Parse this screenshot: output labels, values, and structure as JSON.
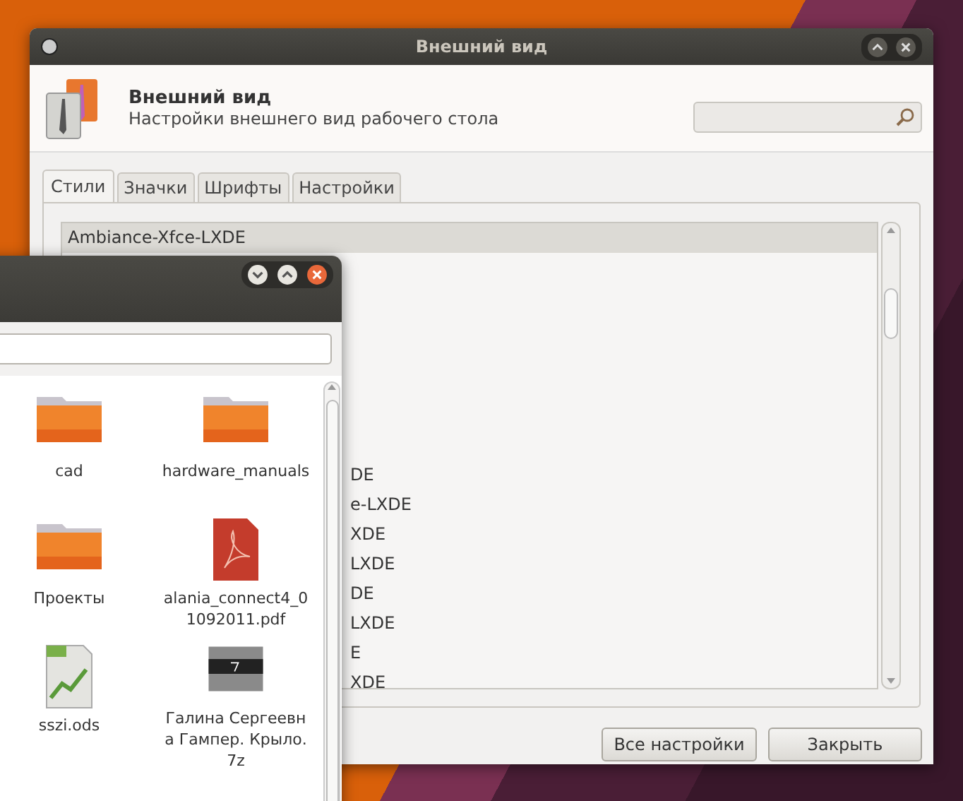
{
  "appearance_window": {
    "title": "Внешний вид",
    "header": {
      "title": "Внешний вид",
      "subtitle": "Настройки внешнего вид рабочего стола"
    },
    "tabs": [
      {
        "label": "Стили",
        "selected": true
      },
      {
        "label": "Значки",
        "selected": false
      },
      {
        "label": "Шрифты",
        "selected": false
      },
      {
        "label": "Настройки",
        "selected": false
      }
    ],
    "themes": [
      {
        "name": "Ambiance-Xfce-LXDE",
        "selected": true,
        "kind": "full"
      },
      {
        "name": "DE",
        "selected": false,
        "kind": "partial"
      },
      {
        "name": "e-LXDE",
        "selected": false,
        "kind": "partial"
      },
      {
        "name": "XDE",
        "selected": false,
        "kind": "partial"
      },
      {
        "name": "LXDE",
        "selected": false,
        "kind": "partial"
      },
      {
        "name": "DE",
        "selected": false,
        "kind": "partial"
      },
      {
        "name": "LXDE",
        "selected": false,
        "kind": "partial"
      },
      {
        "name": "E",
        "selected": false,
        "kind": "partial"
      },
      {
        "name": "XDE",
        "selected": false,
        "kind": "partial"
      }
    ],
    "buttons": [
      "Все настройки",
      "Закрыть"
    ]
  },
  "file_manager": {
    "items": [
      {
        "name": "cad",
        "kind": "folder"
      },
      {
        "name": "hardware_manuals",
        "kind": "folder"
      },
      {
        "name": "Проекты",
        "kind": "folder"
      },
      {
        "name": "alania_connect4_01092011.pdf",
        "kind": "pdf"
      },
      {
        "name": "sszi.ods",
        "kind": "spreadsheet"
      },
      {
        "name": "Галина Сергеевна Гампер. Крыло.7z",
        "kind": "archive"
      }
    ]
  }
}
